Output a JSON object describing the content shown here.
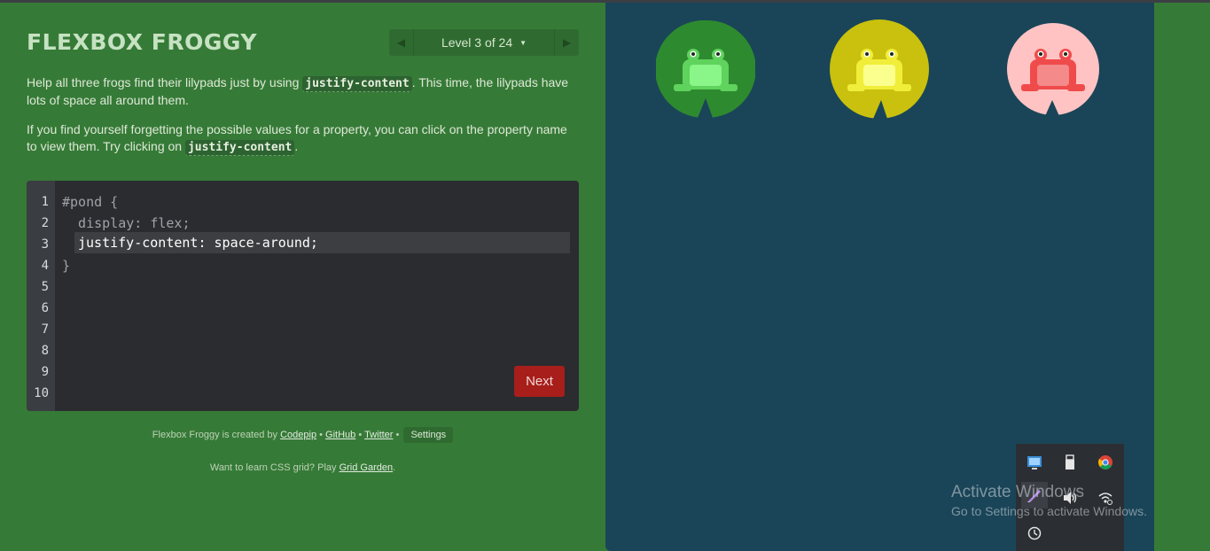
{
  "app": {
    "title": "FLEXBOX FROGGY",
    "level_label": "Level 3 of 24"
  },
  "instructions": {
    "p1_before": "Help all three frogs find their lilypads just by using ",
    "p1_code": "justify-content",
    "p1_after": ". This time, the lilypads have lots of space all around them.",
    "p2_before": "If you find yourself forgetting the possible values for a property, you can click on the property name to view them. Try clicking on ",
    "p2_code": "justify-content",
    "p2_after": "."
  },
  "editor": {
    "line_numbers": [
      "1",
      "2",
      "3",
      "4",
      "5",
      "6",
      "7",
      "8",
      "9",
      "10"
    ],
    "line1": "#pond {",
    "line2": "  display: flex;",
    "input_value": "justify-content: space-around;",
    "line4": "}",
    "next_label": "Next"
  },
  "footer": {
    "created_by": "Flexbox Froggy is created by ",
    "codepip": "Codepip",
    "sep": " • ",
    "github": "GitHub",
    "twitter": "Twitter",
    "settings": "Settings",
    "grid_prefix": "Want to learn CSS grid? Play ",
    "grid_link": "Grid Garden",
    "grid_suffix": "."
  },
  "frogs": [
    {
      "color": "green",
      "pad": "#2e8a2f",
      "body": "#5fd35d"
    },
    {
      "color": "yellow",
      "pad": "#c9c10d",
      "body": "#f0ee3a"
    },
    {
      "color": "red",
      "pad": "#ffc3c3",
      "body": "#f04b4b"
    }
  ],
  "tray": {
    "icons": [
      "network-icon",
      "usb-drive-icon",
      "chrome-icon",
      "pen-icon",
      "volume-icon",
      "wifi-icon",
      "clock-icon"
    ]
  },
  "watermark": {
    "title": "Activate Windows",
    "subtitle": "Go to Settings to activate Windows."
  }
}
